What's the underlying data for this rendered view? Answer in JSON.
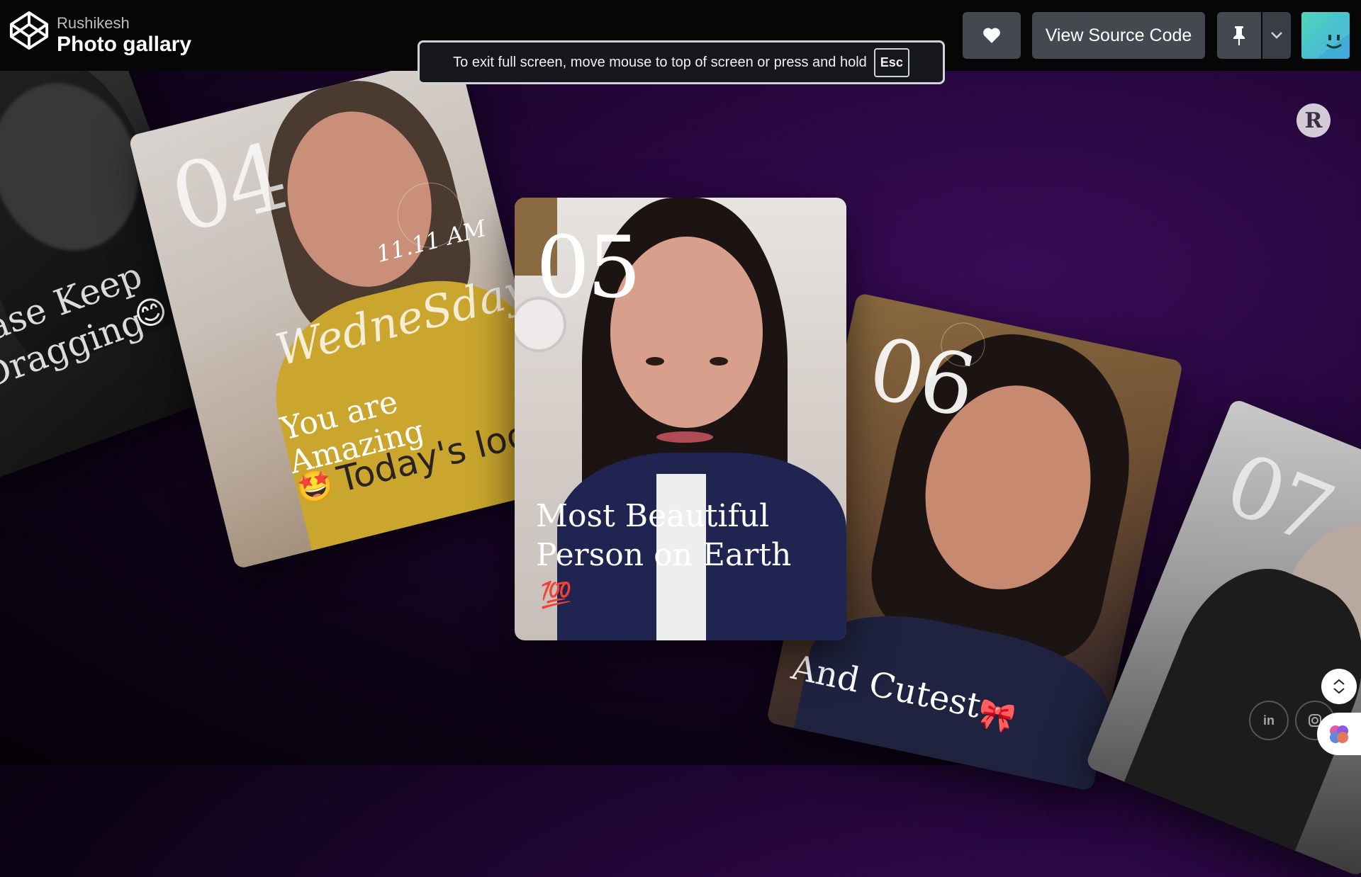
{
  "header": {
    "author": "Rushikesh",
    "title": "Photo gallary",
    "view_source_label": "View Source Code"
  },
  "fullscreen_notice": {
    "message": "To exit full screen, move mouse to top of screen or press and hold",
    "key": "Esc"
  },
  "cards": [
    {
      "number": "",
      "caption_line1": "ease Keep",
      "caption_line2": "Dragging",
      "emoji": "😊"
    },
    {
      "number": "04",
      "time_text": "11.11 AM",
      "day_text": "WedneSday",
      "caption_line1": "You are Amazing",
      "emoji": "🤩",
      "caption_line2": "Today's look"
    },
    {
      "number": "05",
      "caption_line1": "Most Beautiful",
      "caption_line2": "Person on Earth",
      "emoji": "💯"
    },
    {
      "number": "06",
      "caption_line1": "And Cutest",
      "emoji": "🎀"
    },
    {
      "number": "07",
      "caption_line1": "",
      "caption_line2": ""
    }
  ],
  "profile_initial": "R",
  "social": {
    "linkedin": "in"
  },
  "icons": [
    "codepen-logo-icon",
    "heart-icon",
    "pin-icon",
    "chevron-down-icon",
    "linkedin-icon",
    "instagram-icon",
    "recycle-icon",
    "brain-icon"
  ],
  "colors": {
    "topbar": "#060606",
    "button": "#444851",
    "background_accent": "#3a0b58"
  }
}
